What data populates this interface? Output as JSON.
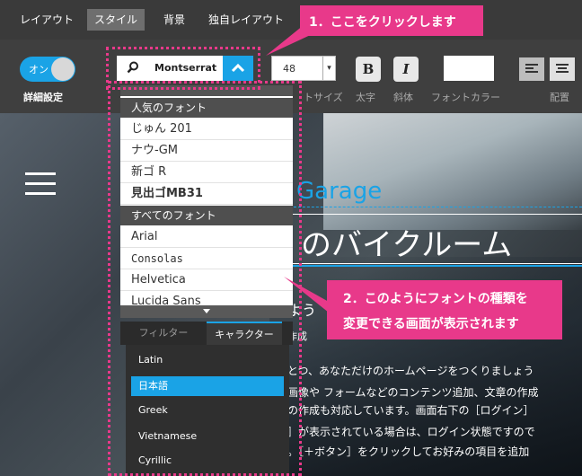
{
  "topbar": {
    "tabs": [
      {
        "label": "レイアウト",
        "active": false
      },
      {
        "label": "スタイル",
        "active": true
      },
      {
        "label": "背景",
        "active": false
      },
      {
        "label": "独自レイアウト",
        "active": false
      }
    ]
  },
  "toolbar": {
    "toggle_label": "オン",
    "detail_label": "詳細設定",
    "font_name": "Montserrat",
    "font_size": "48",
    "bold_label": "B",
    "italic_label": "I",
    "labels": {
      "size": "トサイズ",
      "bold": "太字",
      "italic": "斜体",
      "color": "フォントカラー",
      "align": "配置"
    }
  },
  "dropdown": {
    "popular_heading": "人気のフォント",
    "popular": [
      "じゅん 201",
      "ナウ-GM",
      "新ゴ R",
      "見出ゴMB31"
    ],
    "all_heading": "すべてのフォント",
    "all": [
      "Arial",
      "Consolas",
      "Helvetica",
      "Lucida Sans"
    ]
  },
  "filter_tabs": {
    "filter": "フィルター",
    "character": "キャラクター"
  },
  "charsets": [
    {
      "label": "Latin",
      "selected": false
    },
    {
      "label": "日本語",
      "selected": true
    },
    {
      "label": "Greek",
      "selected": false
    },
    {
      "label": "Vietnamese",
      "selected": false
    },
    {
      "label": "Cyrillic",
      "selected": false
    }
  ],
  "hero": {
    "logo": "Garage",
    "title": "のバイクルーム",
    "subtitle": "よう",
    "subtitle2": "作成",
    "body": [
      "とつ、あなただけのホームページをつくりましょう",
      "画像や フォームなどのコンテンツ追加、文章の作成",
      "の作成も対応しています。画面右下の［ログイン］",
      "］が表示されている場合は、ログイン状態ですので",
      "。［＋ボタン］をクリックしてお好みの項目を追加"
    ]
  },
  "callouts": {
    "step1": "1．ここをクリックします",
    "step2_line1": "2．このようにフォントの種類を",
    "step2_line2": "変更できる画面が表示されます"
  },
  "colors": {
    "accent": "#1aa3e6",
    "annotation": "#e8398a"
  }
}
